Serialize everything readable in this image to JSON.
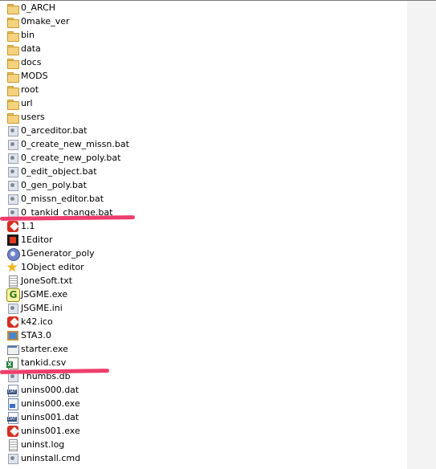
{
  "files": [
    {
      "name": "0_ARCH",
      "icon": "folder-icon"
    },
    {
      "name": "0make_ver",
      "icon": "folder-icon"
    },
    {
      "name": "bin",
      "icon": "folder-icon"
    },
    {
      "name": "data",
      "icon": "folder-icon"
    },
    {
      "name": "docs",
      "icon": "folder-icon"
    },
    {
      "name": "MODS",
      "icon": "folder-icon"
    },
    {
      "name": "root",
      "icon": "folder-icon"
    },
    {
      "name": "url",
      "icon": "folder-icon"
    },
    {
      "name": "users",
      "icon": "folder-icon"
    },
    {
      "name": "0_arceditor.bat",
      "icon": "batch-file-icon"
    },
    {
      "name": "0_create_new_missn.bat",
      "icon": "batch-file-icon"
    },
    {
      "name": "0_create_new_poly.bat",
      "icon": "batch-file-icon"
    },
    {
      "name": "0_edit_object.bat",
      "icon": "batch-file-icon"
    },
    {
      "name": "0_gen_poly.bat",
      "icon": "batch-file-icon"
    },
    {
      "name": "0_missn_editor.bat",
      "icon": "batch-file-icon"
    },
    {
      "name": "0_tankid_change.bat",
      "icon": "batch-file-icon"
    },
    {
      "name": "1.1",
      "icon": "red-icon-file-icon"
    },
    {
      "name": "1Editor",
      "icon": "dark-app-icon"
    },
    {
      "name": "1Generator_poly",
      "icon": "blue-gear-icon"
    },
    {
      "name": "1Object editor",
      "icon": "star-icon"
    },
    {
      "name": "JoneSoft.txt",
      "icon": "text-document-icon"
    },
    {
      "name": "JSGME.exe",
      "icon": "jsgme-app-icon"
    },
    {
      "name": "JSGME.ini",
      "icon": "settings-file-icon"
    },
    {
      "name": "k42.ico",
      "icon": "red-icon-file-icon"
    },
    {
      "name": "STA3.0",
      "icon": "sta-app-icon"
    },
    {
      "name": "starter.exe",
      "icon": "exe-window-icon"
    },
    {
      "name": "tankid.csv",
      "icon": "csv-spreadsheet-icon"
    },
    {
      "name": "Thumbs.db",
      "icon": "settings-file-icon"
    },
    {
      "name": "unins000.dat",
      "icon": "dat-file-icon"
    },
    {
      "name": "unins000.exe",
      "icon": "setup-exe-icon"
    },
    {
      "name": "unins001.dat",
      "icon": "dat-file-icon"
    },
    {
      "name": "unins001.exe",
      "icon": "red-icon-file-icon"
    },
    {
      "name": "uninst.log",
      "icon": "text-document-icon"
    },
    {
      "name": "uninstall.cmd",
      "icon": "settings-file-icon"
    }
  ],
  "colors": {
    "highlight": "#ee3e6d",
    "background": "#ffffff"
  }
}
